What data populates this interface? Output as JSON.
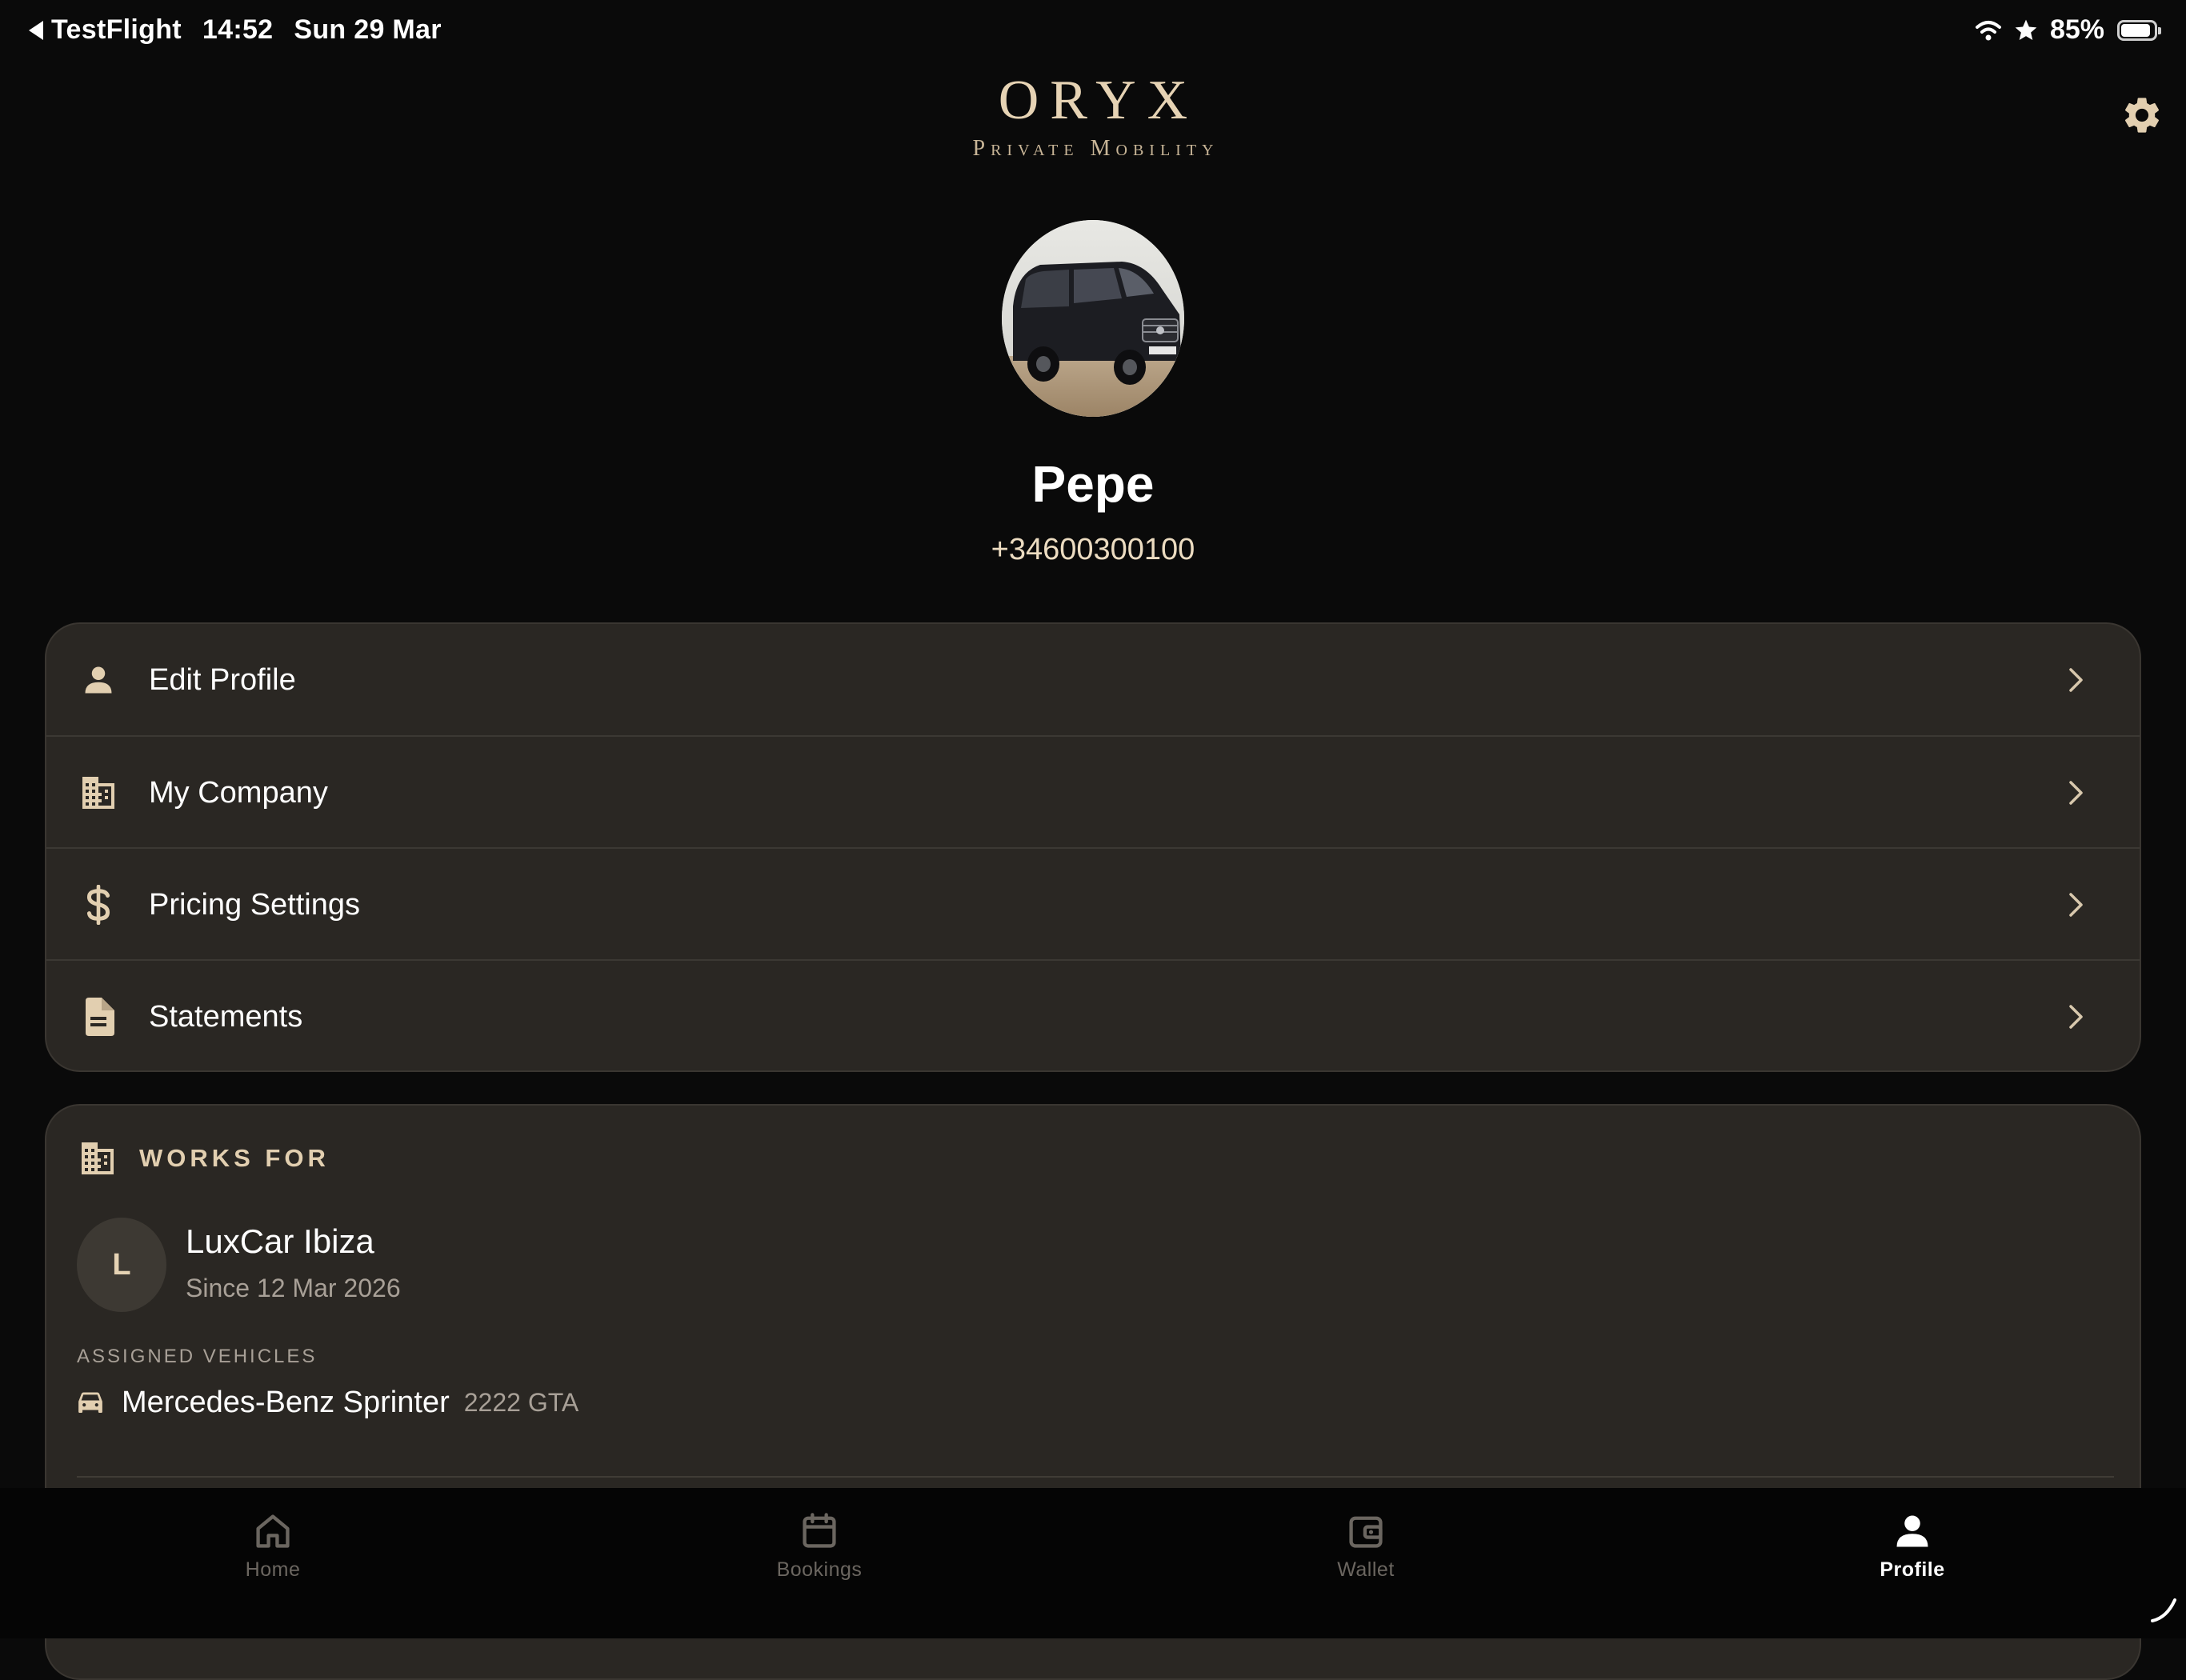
{
  "status_bar": {
    "back_app": "TestFlight",
    "time": "14:52",
    "date": "Sun 29 Mar",
    "battery": "85%"
  },
  "brand": {
    "title": "ORYX",
    "subtitle": "Private Mobility"
  },
  "profile": {
    "name": "Pepe",
    "phone": "+34600300100"
  },
  "menu": {
    "items": [
      {
        "label": "Edit Profile",
        "icon": "person-icon"
      },
      {
        "label": "My Company",
        "icon": "building-icon"
      },
      {
        "label": "Pricing Settings",
        "icon": "dollar-icon"
      },
      {
        "label": "Statements",
        "icon": "document-icon"
      }
    ]
  },
  "works_for": {
    "header": "WORKS FOR",
    "company_initial": "L",
    "company_name": "LuxCar Ibiza",
    "since": "Since 12 Mar 2026",
    "assigned_label": "ASSIGNED VEHICLES",
    "vehicles": [
      {
        "name": "Mercedes-Benz Sprinter",
        "plate": "2222 GTA"
      }
    ]
  },
  "tabs": [
    {
      "label": "Home",
      "icon": "home-icon",
      "active": false
    },
    {
      "label": "Bookings",
      "icon": "calendar-icon",
      "active": false
    },
    {
      "label": "Wallet",
      "icon": "wallet-icon",
      "active": false
    },
    {
      "label": "Profile",
      "icon": "person-icon",
      "active": true
    }
  ],
  "colors": {
    "accent": "#e6d3b4",
    "card": "#2a2723",
    "background": "#0a0a0a"
  }
}
